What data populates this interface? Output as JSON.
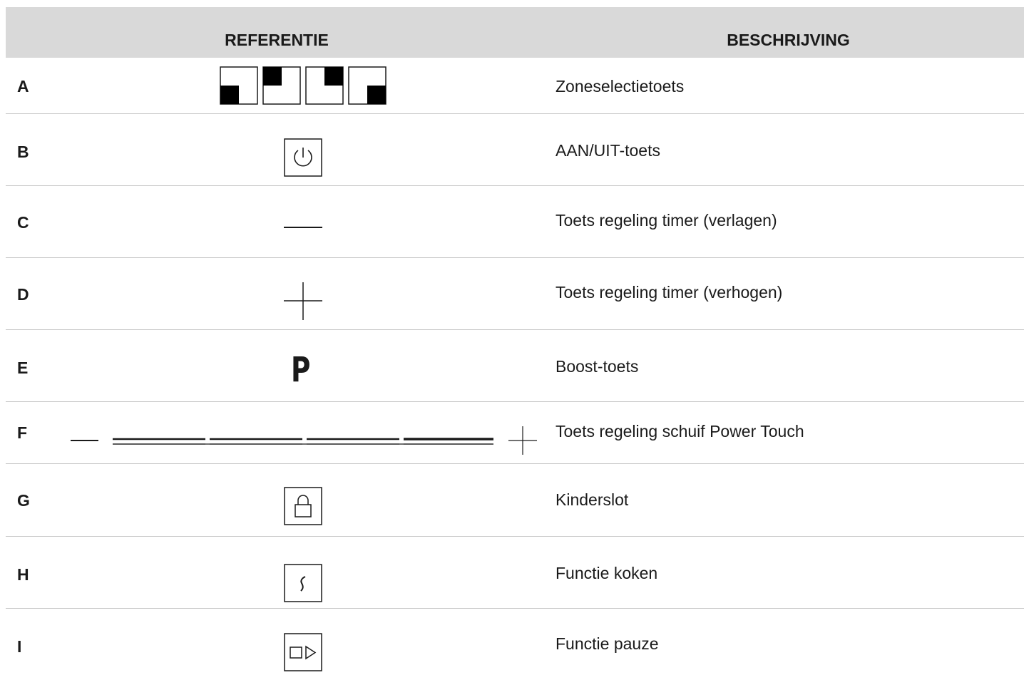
{
  "header": {
    "referentie": "REFERENTIE",
    "beschrijving": "BESCHRIJVING"
  },
  "rows": [
    {
      "letter": "A",
      "icon": "zone-selection-icons",
      "description": "Zoneselectietoets"
    },
    {
      "letter": "B",
      "icon": "power-icon",
      "description": "AAN/UIT-toets"
    },
    {
      "letter": "C",
      "icon": "minus-icon",
      "description": "Toets regeling timer (verlagen)"
    },
    {
      "letter": "D",
      "icon": "plus-icon",
      "description": "Toets regeling timer (verhogen)"
    },
    {
      "letter": "E",
      "icon": "boost-icon",
      "description": "Boost-toets",
      "icon_text": "P"
    },
    {
      "letter": "F",
      "icon": "slider-icon",
      "description": "Toets regeling schuif Power Touch"
    },
    {
      "letter": "G",
      "icon": "lock-icon",
      "description": "Kinderslot"
    },
    {
      "letter": "H",
      "icon": "cooking-icon",
      "description": "Functie koken",
      "icon_text": "∫"
    },
    {
      "letter": "I",
      "icon": "pause-icon",
      "description": "Functie pauze"
    }
  ]
}
